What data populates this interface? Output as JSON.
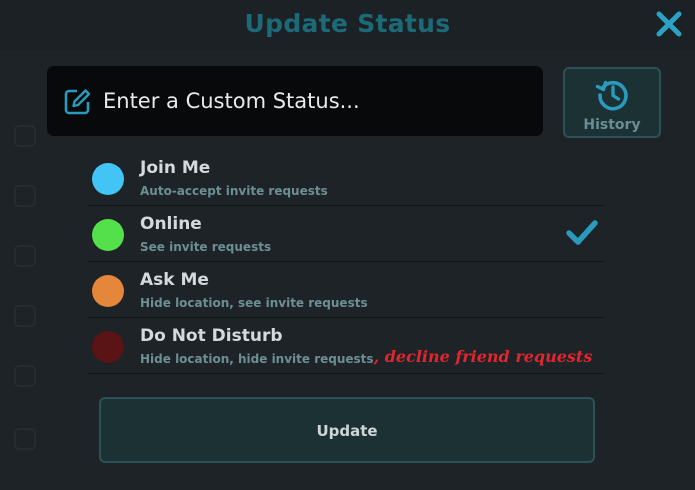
{
  "dialog": {
    "title": "Update Status"
  },
  "custom_status": {
    "placeholder": "Enter a Custom Status...",
    "value": ""
  },
  "history_button": {
    "label": "History"
  },
  "statuses": [
    {
      "label": "Join Me",
      "description": "Auto-accept invite requests",
      "description_extra": "",
      "color": "#42c5f5",
      "selected": false
    },
    {
      "label": "Online",
      "description": "See invite requests",
      "description_extra": "",
      "color": "#54e04a",
      "selected": true
    },
    {
      "label": "Ask Me",
      "description": "Hide location, see invite requests",
      "description_extra": "",
      "color": "#e5873a",
      "selected": false
    },
    {
      "label": "Do Not Disturb",
      "description": "Hide location, hide invite requests",
      "description_extra": ", decline friend requests",
      "color": "#5a1416",
      "selected": false
    }
  ],
  "update_button": {
    "label": "Update"
  },
  "colors": {
    "accent": "#1c6a78",
    "check": "#2a9bbd",
    "annotation": "#e0272f"
  },
  "icons": {
    "close": "close-icon",
    "edit": "edit-icon",
    "history": "history-icon",
    "selected": "check-icon"
  }
}
